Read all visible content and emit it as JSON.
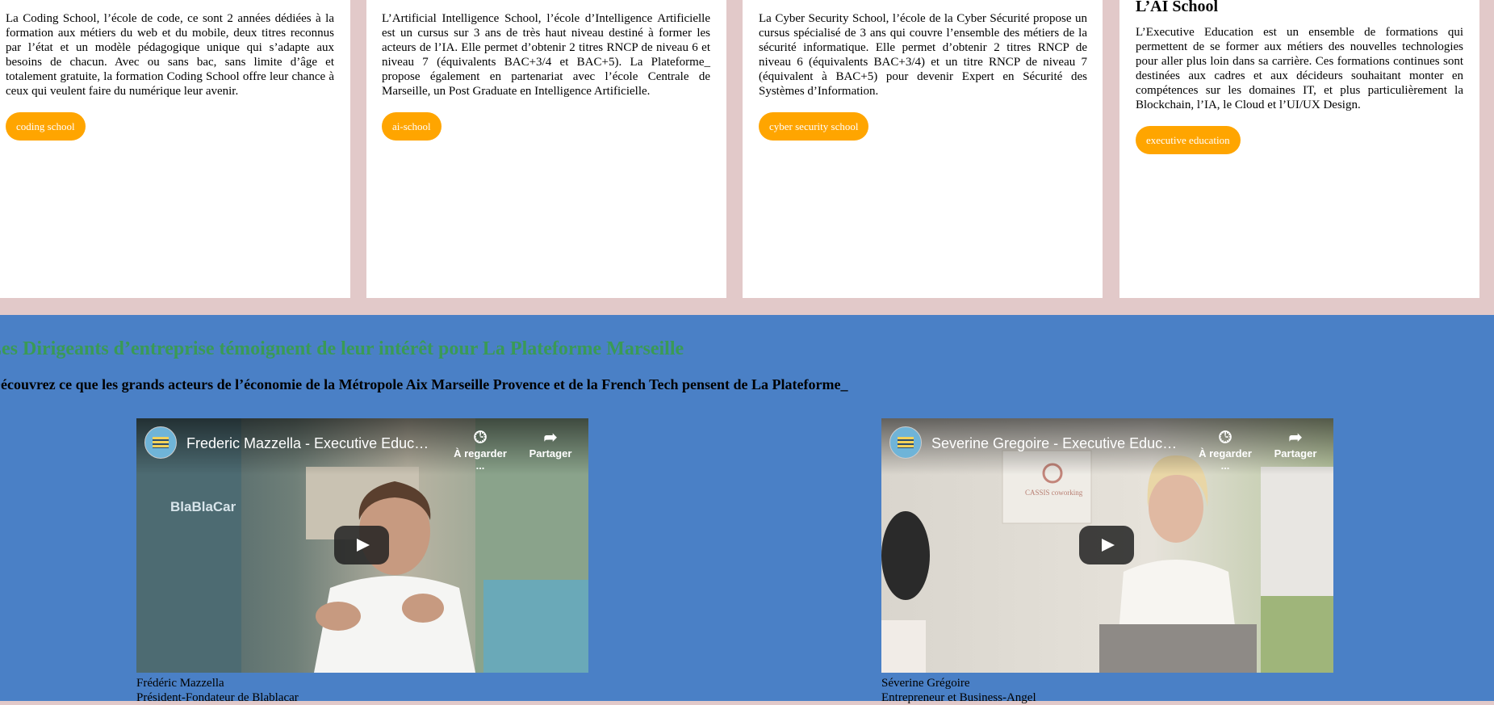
{
  "schools": [
    {
      "title": "",
      "text": "La Coding School, l’école de code, ce sont 2 années dédiées à la formation aux métiers du web et du mobile, deux titres reconnus par l’état et un modèle pédagogique unique qui s’adapte aux besoins de chacun. Avec ou sans bac, sans limite d’âge et totalement gratuite, la formation Coding School offre leur chance à ceux qui veulent faire du numérique leur avenir.",
      "button": "coding school"
    },
    {
      "title": "",
      "text": "L’Artificial Intelligence School, l’école d’Intelligence Artificielle est un cursus sur 3 ans de très haut niveau destiné à former les acteurs de l’IA. Elle permet d’obtenir 2 titres RNCP de niveau 6 et niveau 7 (équivalents BAC+3/4 et BAC+5). La Plateforme_ propose également en partenariat avec l’école Centrale de Marseille, un Post Graduate en Intelligence Artificielle.",
      "button": "ai-school"
    },
    {
      "title": "",
      "text": "La Cyber Security School, l’école de la Cyber Sécurité propose un cursus spécialisé de 3 ans qui couvre l’ensemble des métiers de la sécurité informatique. Elle permet d’obtenir 2 titres RNCP de niveau 6 (équivalents BAC+3/4) et un titre RNCP de niveau 7 (équivalent à BAC+5) pour devenir Expert en Sécurité des Systèmes d’Information.",
      "button": "cyber security school"
    },
    {
      "title": "L’AI School",
      "text": "L’Executive Education est un ensemble de formations qui permettent de se former aux métiers des nouvelles technologies pour aller plus loin dans sa carrière. Ces formations continues sont destinées aux cadres et aux décideurs souhaitant monter en compétences sur les domaines IT, et plus particulièrement la Blockchain, l’IA, le Cloud et l’UI/UX Design.",
      "button": "executive education"
    }
  ],
  "testimonials": {
    "heading": "Les Dirigeants d’entreprise témoignent de leur intérêt pour La Plateforme Marseille",
    "subheading": "Découvrez ce que les grands acteurs de l’économie de la Métropole Aix Marseille Provence et de la French Tech pensent de La Plateforme_",
    "videos": [
      {
        "title": "Frederic Mazzella - Executive Educati...",
        "watch_later": "À regarder ...",
        "share": "Partager",
        "name": "Frédéric Mazzella",
        "role": "Président-Fondateur de Blablacar"
      },
      {
        "title": "Severine Gregoire - Executive Educati...",
        "watch_later": "À regarder ...",
        "share": "Partager",
        "name": "Séverine Grégoire",
        "role": "Entrepreneur et Business-Angel"
      }
    ]
  },
  "colors": {
    "accent_button": "#ffa500",
    "section_blue": "#4a80c6",
    "heading_green": "#3a9a55",
    "card_gap": "#e2c9c9"
  },
  "icons": [
    "channel-avatar-icon",
    "clock-icon",
    "share-icon",
    "play-icon"
  ]
}
